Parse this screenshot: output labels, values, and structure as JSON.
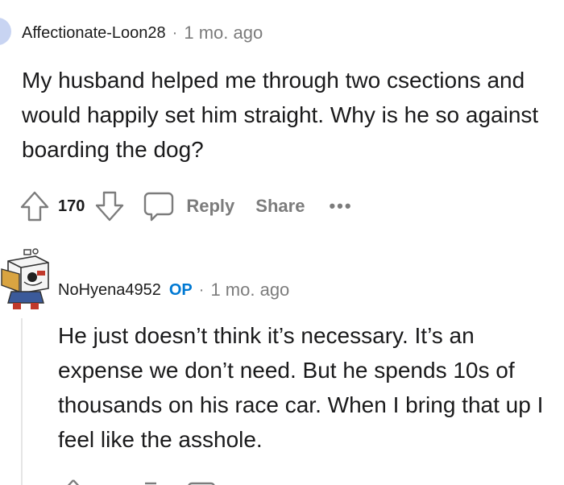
{
  "comment1": {
    "author": "Affectionate-Loon28",
    "separator": "·",
    "time": "1 mo. ago",
    "body": "My husband helped me through two csections and would happily set him straight. Why is he so against boarding the dog?",
    "score": "170",
    "reply_label": "Reply",
    "share_label": "Share",
    "more_label": "•••",
    "icons": [
      "upvote-icon",
      "downvote-icon",
      "reply-bubble-icon",
      "more-icon"
    ]
  },
  "comment2": {
    "author": "NoHyena4952",
    "op_badge": "OP",
    "separator": "·",
    "time": "1 mo. ago",
    "body": "He just doesn’t think it’s necessary. It’s an expense we don’t need. But he spends 10s of thousands on his race car. When I bring that up I feel like the asshole.",
    "icons": [
      "robot-avatar-icon",
      "upvote-icon",
      "downvote-icon",
      "reply-bubble-icon"
    ]
  },
  "colors": {
    "accent": "#0079d3",
    "meta_text": "#7c7c7c",
    "body_text": "#1a1a1b",
    "thread_line": "#e5e5e5"
  }
}
